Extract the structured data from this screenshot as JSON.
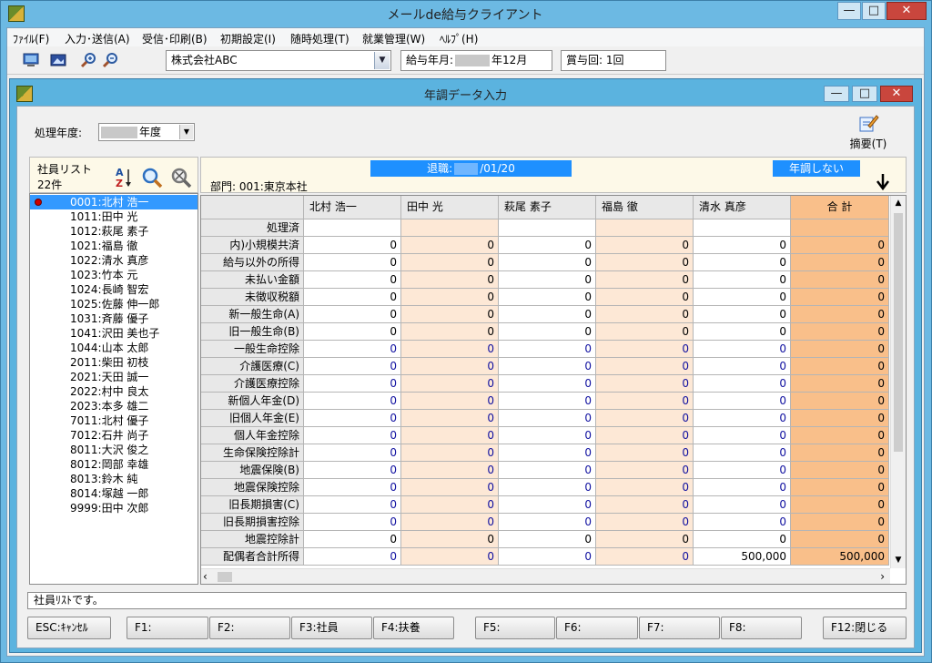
{
  "window": {
    "title": "メールde給与クライアント",
    "min": "—",
    "max": "□",
    "close": "✕"
  },
  "menu": [
    "ﾌｧｲﾙ(F)",
    "入力･送信(A)",
    "受信･印刷(B)",
    "初期設定(I)",
    "随時処理(T)",
    "就業管理(W)",
    "ﾍﾙﾌﾟ(H)"
  ],
  "toolbar": {
    "company": "株式会社ABC",
    "pay_month_label": "給与年月:",
    "pay_month_value": "年12月",
    "bonus_label": "賞与回:",
    "bonus_value": "1回"
  },
  "child": {
    "title": "年調データ入力",
    "min": "—",
    "max": "□",
    "close": "✕"
  },
  "year": {
    "label": "処理年度:",
    "value": "年度"
  },
  "summary_button": "摘要(T)",
  "list": {
    "title": "社員リスト",
    "count": "22件",
    "sort_icon_text": "AZ",
    "employees": [
      "0001:北村 浩一",
      "1011:田中 光",
      "1012:萩尾 素子",
      "1021:福島 徹",
      "1022:清水 真彦",
      "1023:竹本 元",
      "1024:長崎 智宏",
      "1025:佐藤 伸一郎",
      "1031:斉藤 優子",
      "1041:沢田 美也子",
      "1044:山本 太郎",
      "2011:柴田 初枝",
      "2021:天田 誠一",
      "2022:村中 良太",
      "2023:本多 雄二",
      "7011:北村 優子",
      "7012:石井 尚子",
      "8011:大沢 俊之",
      "8012:岡部 幸雄",
      "8013:鈴木 純",
      "8014:塚越 一郎",
      "9999:田中 次郎"
    ]
  },
  "info": {
    "retire_label": "退職:",
    "retire_value": "/01/20",
    "nencho": "年調しない",
    "dept": "部門: 001:東京本社"
  },
  "grid": {
    "columns": [
      "北村 浩一",
      "田中 光",
      "萩尾 素子",
      "福島 徹",
      "清水 真彦",
      "合 計"
    ],
    "rows": [
      {
        "label": "処理済",
        "values": [
          "",
          "",
          "",
          "",
          "",
          ""
        ]
      },
      {
        "label": "内)小規模共済",
        "values": [
          "0",
          "0",
          "0",
          "0",
          "0",
          "0"
        ]
      },
      {
        "label": "給与以外の所得",
        "values": [
          "0",
          "0",
          "0",
          "0",
          "0",
          "0"
        ]
      },
      {
        "label": "未払い金額",
        "values": [
          "0",
          "0",
          "0",
          "0",
          "0",
          "0"
        ]
      },
      {
        "label": "未徴収税額",
        "values": [
          "0",
          "0",
          "0",
          "0",
          "0",
          "0"
        ]
      },
      {
        "label": "新一般生命(A)",
        "values": [
          "0",
          "0",
          "0",
          "0",
          "0",
          "0"
        ]
      },
      {
        "label": "旧一般生命(B)",
        "values": [
          "0",
          "0",
          "0",
          "0",
          "0",
          "0"
        ]
      },
      {
        "label": "一般生命控除",
        "values": [
          "0",
          "0",
          "0",
          "0",
          "0",
          "0"
        ]
      },
      {
        "label": "介護医療(C)",
        "values": [
          "0",
          "0",
          "0",
          "0",
          "0",
          "0"
        ]
      },
      {
        "label": "介護医療控除",
        "values": [
          "0",
          "0",
          "0",
          "0",
          "0",
          "0"
        ]
      },
      {
        "label": "新個人年金(D)",
        "values": [
          "0",
          "0",
          "0",
          "0",
          "0",
          "0"
        ]
      },
      {
        "label": "旧個人年金(E)",
        "values": [
          "0",
          "0",
          "0",
          "0",
          "0",
          "0"
        ]
      },
      {
        "label": "個人年金控除",
        "values": [
          "0",
          "0",
          "0",
          "0",
          "0",
          "0"
        ]
      },
      {
        "label": "生命保険控除計",
        "values": [
          "0",
          "0",
          "0",
          "0",
          "0",
          "0"
        ]
      },
      {
        "label": "地震保険(B)",
        "values": [
          "0",
          "0",
          "0",
          "0",
          "0",
          "0"
        ]
      },
      {
        "label": "地震保険控除",
        "values": [
          "0",
          "0",
          "0",
          "0",
          "0",
          "0"
        ]
      },
      {
        "label": "旧長期損害(C)",
        "values": [
          "0",
          "0",
          "0",
          "0",
          "0",
          "0"
        ]
      },
      {
        "label": "旧長期損害控除",
        "values": [
          "0",
          "0",
          "0",
          "0",
          "0",
          "0"
        ]
      },
      {
        "label": "地震控除計",
        "values": [
          "0",
          "0",
          "0",
          "0",
          "0",
          "0"
        ]
      },
      {
        "label": "配偶者合計所得",
        "values": [
          "0",
          "0",
          "0",
          "0",
          "500,000",
          "500,000"
        ]
      }
    ]
  },
  "status": "社員ﾘｽﾄです。",
  "fkeys": [
    "ESC:ｷｬﾝｾﾙ",
    "F1:",
    "F2:",
    "F3:社員",
    "F4:扶養",
    "F5:",
    "F6:",
    "F7:",
    "F8:",
    "F12:閉じる"
  ]
}
